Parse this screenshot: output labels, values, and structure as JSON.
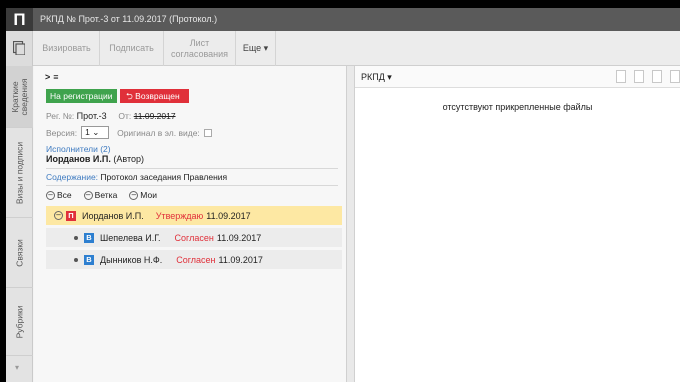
{
  "window": {
    "logo_letter": "П",
    "title": "РКПД № Прот.-3 от 11.09.2017 (Протокол.)"
  },
  "toolbar": {
    "buttons": [
      {
        "label": "Визировать",
        "enabled": false
      },
      {
        "label": "Подписать",
        "enabled": false
      },
      {
        "label": "Лист\nсогласования",
        "enabled": false
      },
      {
        "label": "Еще ▾",
        "enabled": true
      }
    ]
  },
  "vtabs": [
    {
      "label": "Краткие сведения",
      "active": true
    },
    {
      "label": "Визы и подписи",
      "active": false
    },
    {
      "label": "Связки",
      "active": false
    },
    {
      "label": "Рубрики",
      "active": false
    }
  ],
  "doc": {
    "collapse_label": ">",
    "menu_label": "≡",
    "status_registration": "На регистрации",
    "status_returned": "⮌ Возвращен",
    "reg_no_label": "Рег. №:",
    "reg_no": "Прот.-3",
    "from_label": "От:",
    "date": "11.09.2017",
    "version_label": "Версия:",
    "version_value": "1",
    "original_label": "Оригинал в эл. виде:",
    "executors_link": "Исполнители (2)",
    "author_name": "Иорданов И.П.",
    "author_role": "(Автор)",
    "content_label": "Содержание:",
    "content_value": "Протокол заседания Правления"
  },
  "filters": [
    {
      "label": "Все"
    },
    {
      "label": "Ветка"
    },
    {
      "label": "Мои"
    }
  ],
  "tree": [
    {
      "badge": "П",
      "name": "Иорданов И.П.",
      "status": "Утверждаю",
      "date": "11.09.2017",
      "level": 0
    },
    {
      "badge": "В",
      "name": "Шепелева И.Г.",
      "status": "Согласен",
      "date": "11.09.2017",
      "level": 1
    },
    {
      "badge": "В",
      "name": "Дынников Н.Ф.",
      "status": "Согласен",
      "date": "11.09.2017",
      "level": 1
    }
  ],
  "right_panel": {
    "title": "РКПД ▾",
    "empty_text": "отсутствуют прикрепленные файлы"
  },
  "colors": {
    "accent_red": "#e0303a",
    "accent_green": "#3fa34d",
    "highlight": "#fde8a3",
    "link": "#3d7ac0"
  }
}
